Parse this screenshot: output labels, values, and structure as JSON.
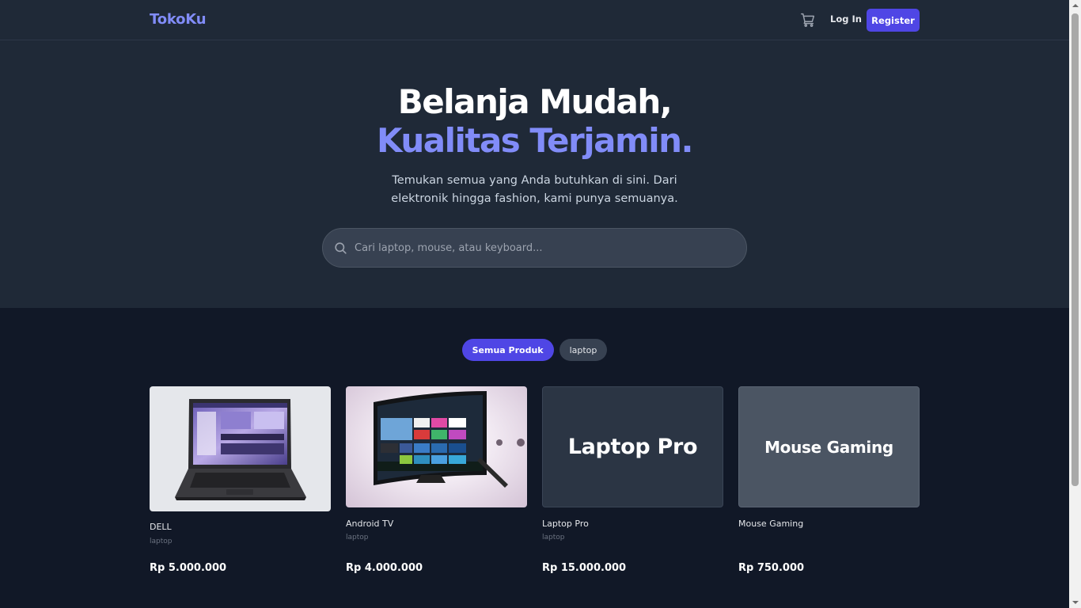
{
  "nav": {
    "brand": "TokoKu",
    "login_label": "Log In",
    "register_label": "Register",
    "cart_icon": "cart-icon"
  },
  "hero": {
    "title_line1": "Belanja Mudah,",
    "title_line2": "Kualitas Terjamin.",
    "subtitle": "Temukan semua yang Anda butuhkan di sini. Dari elektronik hingga fashion, kami punya semuanya."
  },
  "search": {
    "placeholder": "Cari laptop, mouse, atau keyboard...",
    "value": ""
  },
  "filters": [
    {
      "label": "Semua Produk",
      "active": true
    },
    {
      "label": "laptop",
      "active": false
    }
  ],
  "products": [
    {
      "name": "DELL",
      "category": "laptop",
      "price": "Rp 5.000.000"
    },
    {
      "name": "Android TV",
      "category": "laptop",
      "price": "Rp 4.000.000"
    },
    {
      "name": "Laptop Pro",
      "category": "laptop",
      "price": "Rp 15.000.000",
      "thumb_text": "Laptop Pro"
    },
    {
      "name": "Mouse Gaming",
      "category": "",
      "price": "Rp 750.000",
      "thumb_text": "Mouse Gaming"
    }
  ],
  "colors": {
    "accent": "#4f46e5",
    "accent_text": "#818cf8",
    "bg_dark": "#111827",
    "bg_panel": "#1f2937"
  }
}
